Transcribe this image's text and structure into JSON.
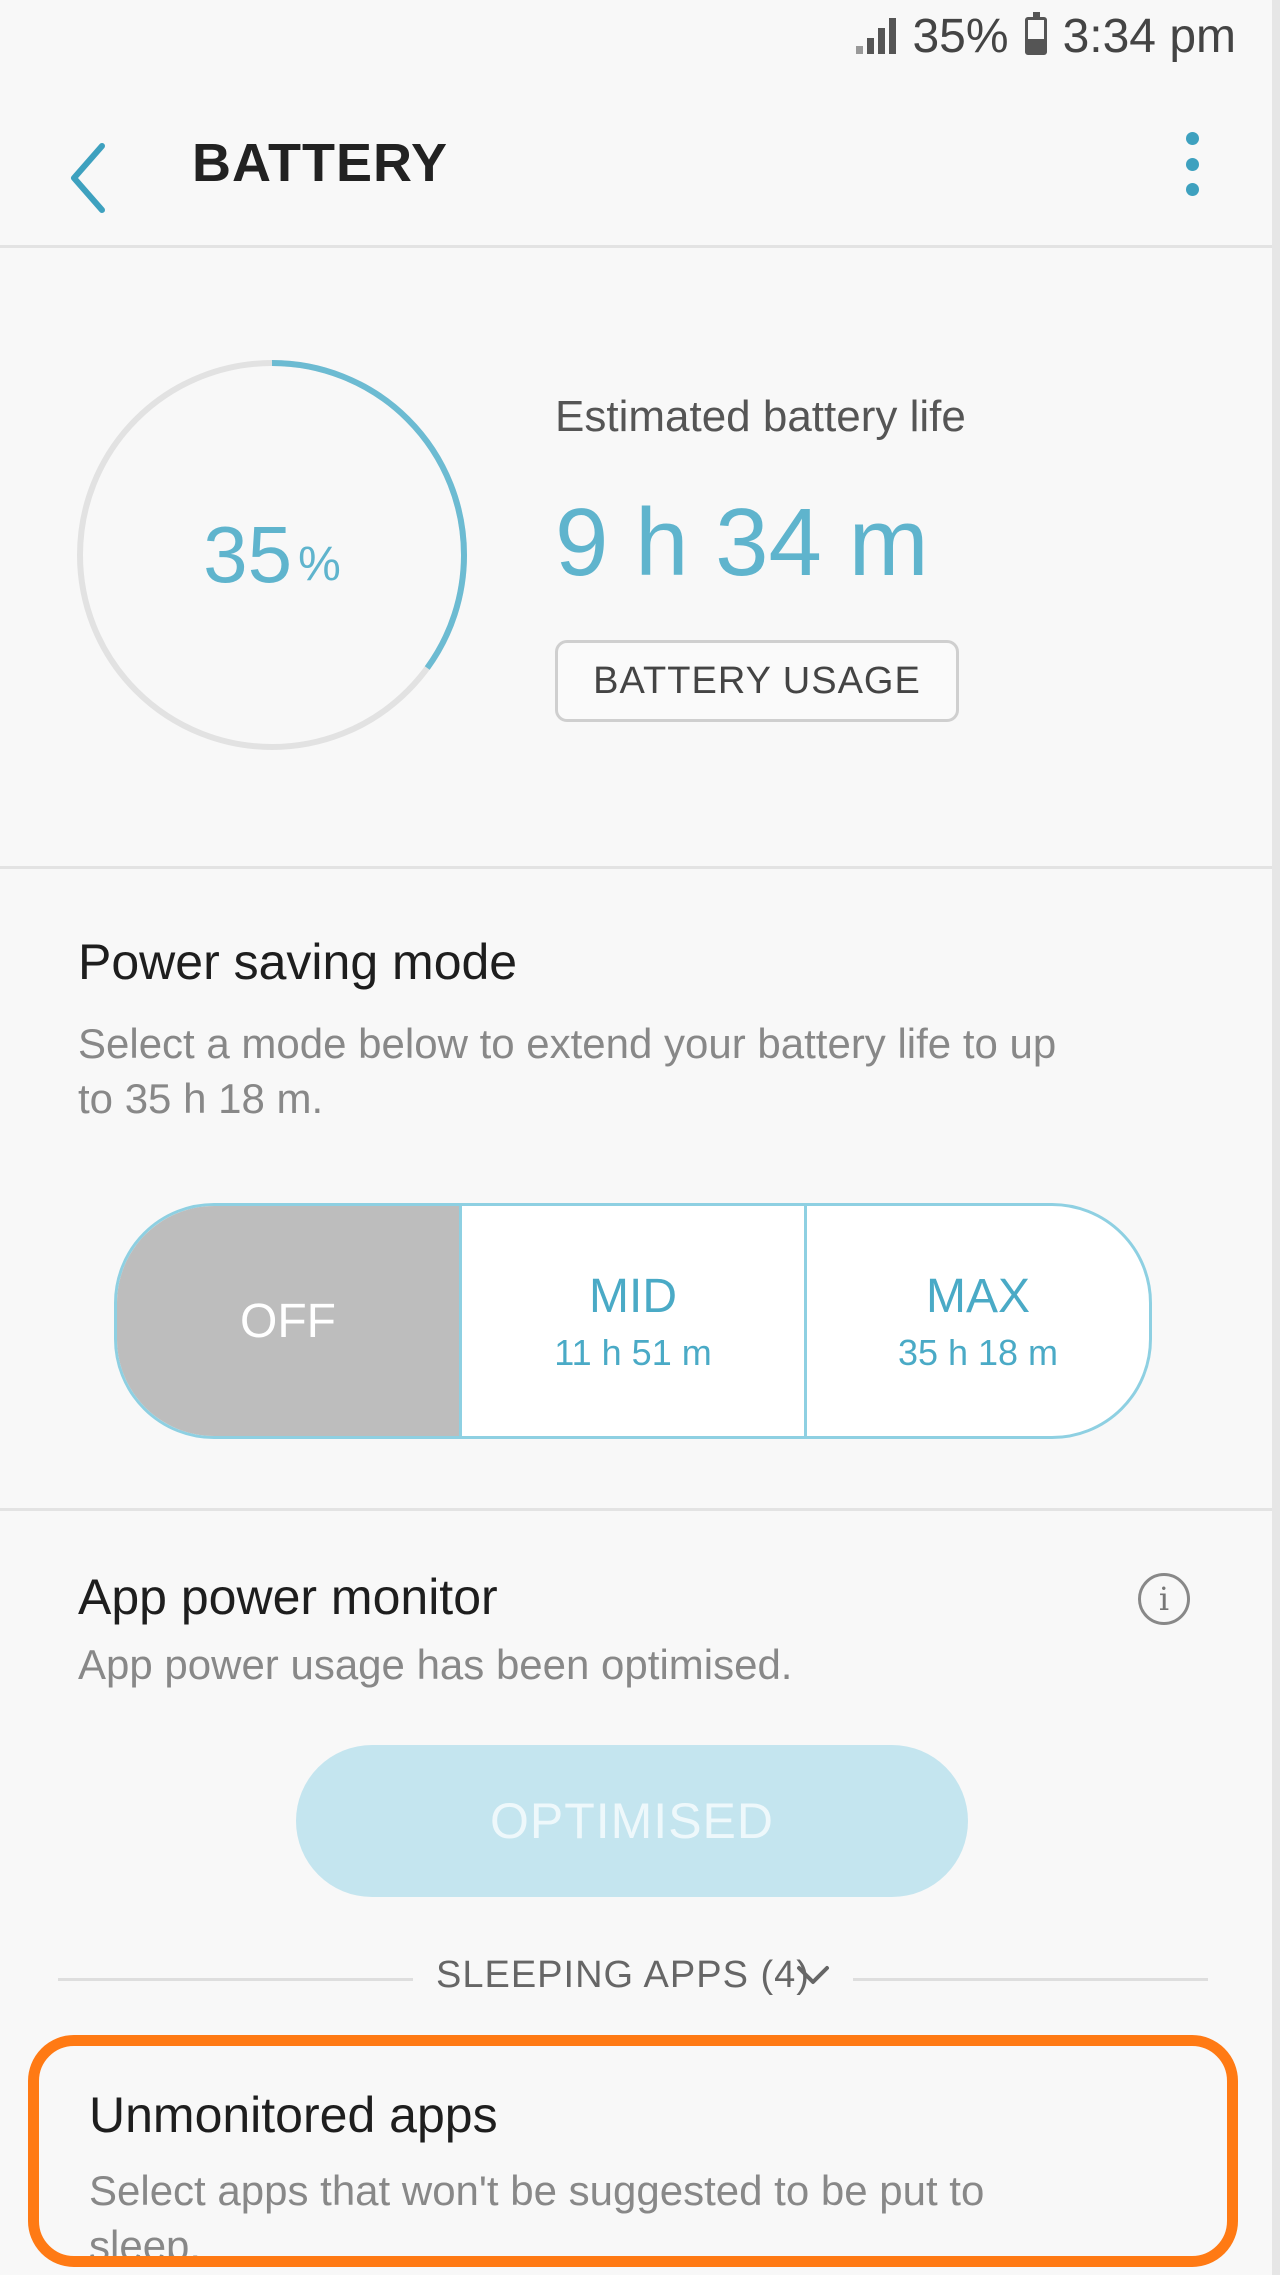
{
  "status_bar": {
    "battery_percent": "35%",
    "time": "3:34 pm",
    "icons": [
      "signal-icon",
      "battery-icon"
    ]
  },
  "header": {
    "title": "BATTERY",
    "back_icon": "chevron-left-icon",
    "menu_icon": "more-vertical-icon"
  },
  "battery": {
    "level_percent": 35,
    "level_number": "35",
    "level_unit": "%",
    "estimate_label": "Estimated battery life",
    "estimate_value": "9 h 34 m",
    "usage_button_label": "BATTERY USAGE"
  },
  "power_saving": {
    "title": "Power saving mode",
    "description_line1": "Select a mode below to extend your battery life to up",
    "description_line2": "to 35 h 18 m.",
    "modes": [
      {
        "label": "OFF",
        "time": "",
        "selected": true
      },
      {
        "label": "MID",
        "time": "11 h 51 m",
        "selected": false
      },
      {
        "label": "MAX",
        "time": "35 h 18 m",
        "selected": false
      }
    ]
  },
  "app_power_monitor": {
    "title": "App power monitor",
    "description": "App power usage has been optimised.",
    "info_icon_glyph": "i",
    "button_label": "OPTIMISED",
    "sleeping_apps_label": "SLEEPING APPS (4)"
  },
  "unmonitored_apps": {
    "title": "Unmonitored apps",
    "description_line1": "Select apps that won't be suggested to be put to",
    "description_line2": "sleep."
  },
  "colors": {
    "accent": "#5fb4cd",
    "selected_mode_bg": "#bdbdbd",
    "optimised_button_bg": "#c4e5ef",
    "highlight_border": "#ff7a14"
  }
}
